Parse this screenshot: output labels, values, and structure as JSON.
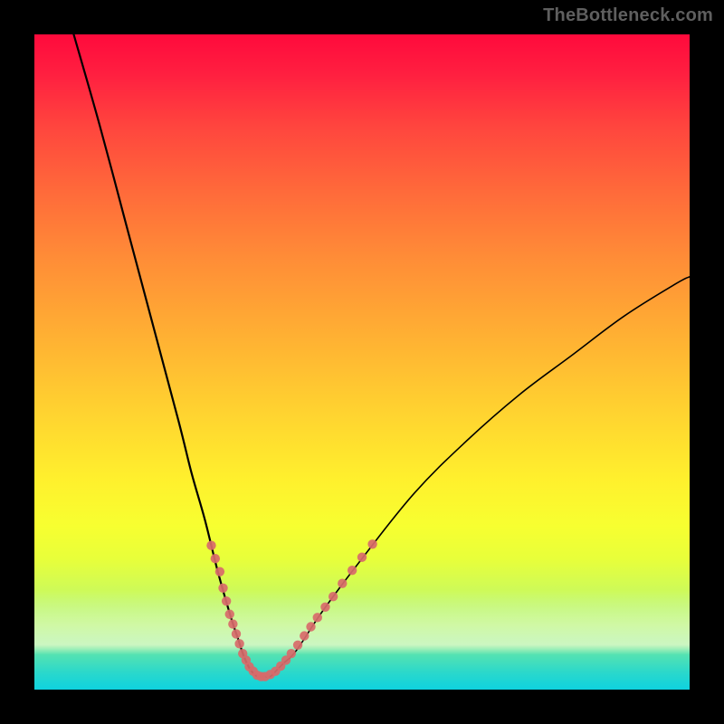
{
  "attribution": "TheBottleneck.com",
  "chart_data": {
    "type": "line",
    "title": "",
    "xlabel": "",
    "ylabel": "",
    "xlim": [
      0,
      100
    ],
    "ylim": [
      0,
      100
    ],
    "grid": false,
    "background_gradient_top": "#ff0a3c",
    "background_gradient_mid": "#ffd130",
    "background_gradient_bottom": "#0fd2de",
    "series": [
      {
        "name": "bottleneck-curve",
        "x": [
          6,
          10,
          14,
          18,
          22,
          24,
          26,
          28,
          30,
          31,
          32,
          33,
          34,
          35,
          36,
          37,
          38,
          40,
          44,
          50,
          58,
          66,
          74,
          82,
          90,
          98,
          100
        ],
        "values": [
          100,
          86,
          71,
          56,
          41,
          33,
          26,
          18,
          11,
          8,
          5,
          3,
          2,
          2,
          2,
          3,
          4,
          6,
          12,
          20,
          30,
          38,
          45,
          51,
          57,
          62,
          63
        ]
      }
    ],
    "highlight_points": {
      "name": "highlighted-samples",
      "color": "#d86a6a",
      "points": [
        {
          "x": 27.0,
          "y": 22.0
        },
        {
          "x": 27.6,
          "y": 20.0
        },
        {
          "x": 28.3,
          "y": 18.0
        },
        {
          "x": 28.8,
          "y": 15.5
        },
        {
          "x": 29.3,
          "y": 13.5
        },
        {
          "x": 29.8,
          "y": 11.5
        },
        {
          "x": 30.3,
          "y": 10.0
        },
        {
          "x": 30.8,
          "y": 8.5
        },
        {
          "x": 31.3,
          "y": 7.0
        },
        {
          "x": 31.8,
          "y": 5.5
        },
        {
          "x": 32.3,
          "y": 4.5
        },
        {
          "x": 32.8,
          "y": 3.5
        },
        {
          "x": 33.4,
          "y": 2.8
        },
        {
          "x": 34.0,
          "y": 2.2
        },
        {
          "x": 34.6,
          "y": 2.0
        },
        {
          "x": 35.2,
          "y": 2.0
        },
        {
          "x": 36.0,
          "y": 2.3
        },
        {
          "x": 36.8,
          "y": 2.8
        },
        {
          "x": 37.6,
          "y": 3.6
        },
        {
          "x": 38.4,
          "y": 4.5
        },
        {
          "x": 39.2,
          "y": 5.5
        },
        {
          "x": 40.2,
          "y": 6.8
        },
        {
          "x": 41.2,
          "y": 8.2
        },
        {
          "x": 42.2,
          "y": 9.6
        },
        {
          "x": 43.2,
          "y": 11.0
        },
        {
          "x": 44.4,
          "y": 12.6
        },
        {
          "x": 45.6,
          "y": 14.2
        },
        {
          "x": 47.0,
          "y": 16.2
        },
        {
          "x": 48.5,
          "y": 18.2
        },
        {
          "x": 50.0,
          "y": 20.2
        },
        {
          "x": 51.6,
          "y": 22.2
        }
      ]
    }
  }
}
